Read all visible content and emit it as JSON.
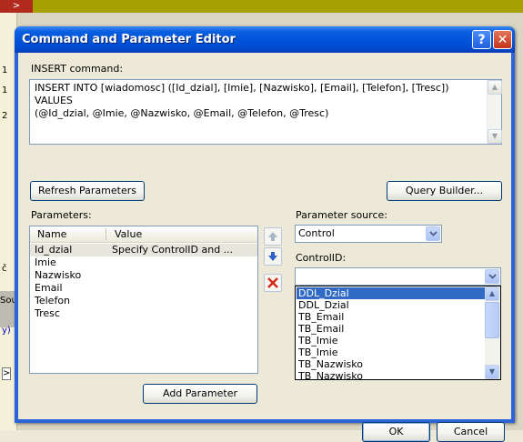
{
  "background": {
    "top_glyph": ">",
    "left_fragments": [
      "1",
      "1",
      "2",
      "č",
      "Sou",
      "y)",
      ">"
    ]
  },
  "dialog": {
    "title": "Command and Parameter Editor",
    "help_glyph": "?",
    "close_glyph": "✕",
    "insert_label": "INSERT command:",
    "insert_text": "INSERT INTO [wiadomosc] ([Id_dzial], [Imie], [Nazwisko], [Email], [Telefon], [Tresc]) VALUES\n(@Id_dzial, @Imie, @Nazwisko, @Email, @Telefon, @Tresc)",
    "refresh_button": "Refresh Parameters",
    "query_builder_button": "Query Builder...",
    "parameters_label": "Parameters:",
    "columns": [
      "Name",
      "Value"
    ],
    "parameters": [
      {
        "name": "Id_dzial",
        "value": "Specify ControlID and ..."
      },
      {
        "name": "Imie",
        "value": ""
      },
      {
        "name": "Nazwisko",
        "value": ""
      },
      {
        "name": "Email",
        "value": ""
      },
      {
        "name": "Telefon",
        "value": ""
      },
      {
        "name": "Tresc",
        "value": ""
      }
    ],
    "add_parameter_button": "Add Parameter",
    "parameter_source_label": "Parameter source:",
    "parameter_source_value": "Control",
    "controlid_label": "ControlID:",
    "controlid_value": "",
    "controlid_options": [
      "DDL_Dzial",
      "DDL_Dzial",
      "TB_Email",
      "TB_Email",
      "TB_Imie",
      "TB_Imie",
      "TB_Nazwisko",
      "TB_Nazwisko"
    ],
    "ok_button": "OK",
    "cancel_button": "Cancel"
  },
  "colors": {
    "titlebar": "#0052d6",
    "selection": "#316ac5",
    "close_button": "#c1341a"
  }
}
